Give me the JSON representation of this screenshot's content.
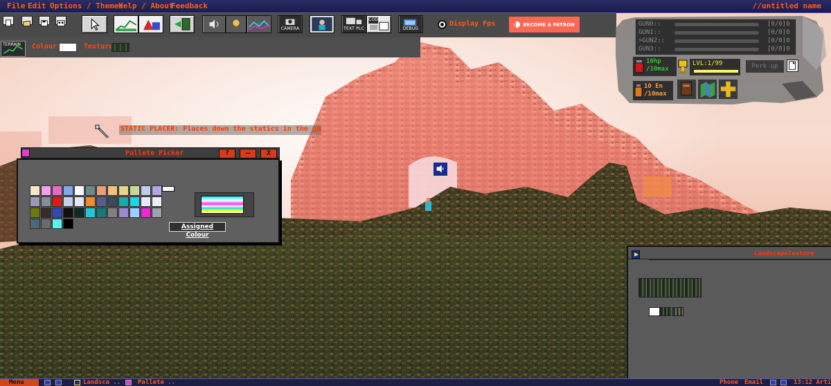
{
  "window_title": "//untitled name",
  "menu": [
    "File",
    "Edit",
    "Options / Themes",
    "Help / About",
    "Feedback"
  ],
  "toolbar": {
    "camera_label": "CAMERA",
    "text_plc_label": "TEXT PLC",
    "code_label": "CODE",
    "debug_label": "DEBUG",
    "display_fps": "Display Fps",
    "patron_label": "BECOME A PATRON"
  },
  "subbar": {
    "terrain_label": "TERRAIN",
    "colour_label": "Colour:",
    "texture_label": "Texture"
  },
  "tooltip": "STATIC PLACER: Places down the statics in the game world",
  "picker": {
    "title": "Pallete Picker",
    "help": "?",
    "minimize": "—",
    "close": "X",
    "assigned_label": "Assigned Colour",
    "swatches": [
      "#f2e8c8",
      "#f1a0f0",
      "#e36cc8",
      "#7fa6ee",
      "#ffffff",
      "#6c8a8a",
      "#e8a07c",
      "#f2c080",
      "#e6d48a",
      "#c8d89a",
      "#c0cce8",
      "#b0a6e8",
      "#9a9ab8",
      "#8a8a9a",
      "#e01818",
      "#c8d0e8",
      "#e0e8f8",
      "#f08a2a",
      "#52608a",
      "#3a4a58",
      "#1aa8a8",
      "#18d8e8",
      "#e8e8ff",
      "#f0f0f0",
      "#6a7a10",
      "#3a2a28",
      "#3048b0",
      "#101010",
      "#102a28",
      "#20c8d8",
      "#187878",
      "#808080",
      "#9a8ad0",
      "#9ad0ff",
      "#e82ad0",
      "#a0a0b0",
      "#4a6878",
      "#6a6a6a",
      "#58f0f0",
      "#000000"
    ]
  },
  "status": {
    "guns": [
      {
        "label": "GUN0::",
        "count": "[0/0]0"
      },
      {
        "label": "GUN1::",
        "count": "[0/0]0"
      },
      {
        "label": ">GUN2::",
        "count": "[0/0]0"
      },
      {
        "label": "GUN3::",
        "count": "[0/0]0"
      }
    ],
    "hp": "10hp",
    "hp_max": "/10max",
    "energy": "10 En",
    "energy_max": "/10max",
    "level": "LVL:1/99",
    "perk_label": "Perk up"
  },
  "landscape": {
    "title": "LandscapeTexture"
  },
  "taskbar": {
    "menu_label": "Menu",
    "items": [
      "Landsca ..",
      "Pallete .."
    ],
    "phone": "Phone",
    "email": "Email",
    "time": "13:12 Arti"
  },
  "colors": {
    "accent": "#ff5a1e",
    "menubar": "#1b1c4a",
    "patron": "#f96854",
    "hp_text": "#2dff2d",
    "energy_text": "#ff9a3a",
    "level_text": "#ffe633"
  }
}
